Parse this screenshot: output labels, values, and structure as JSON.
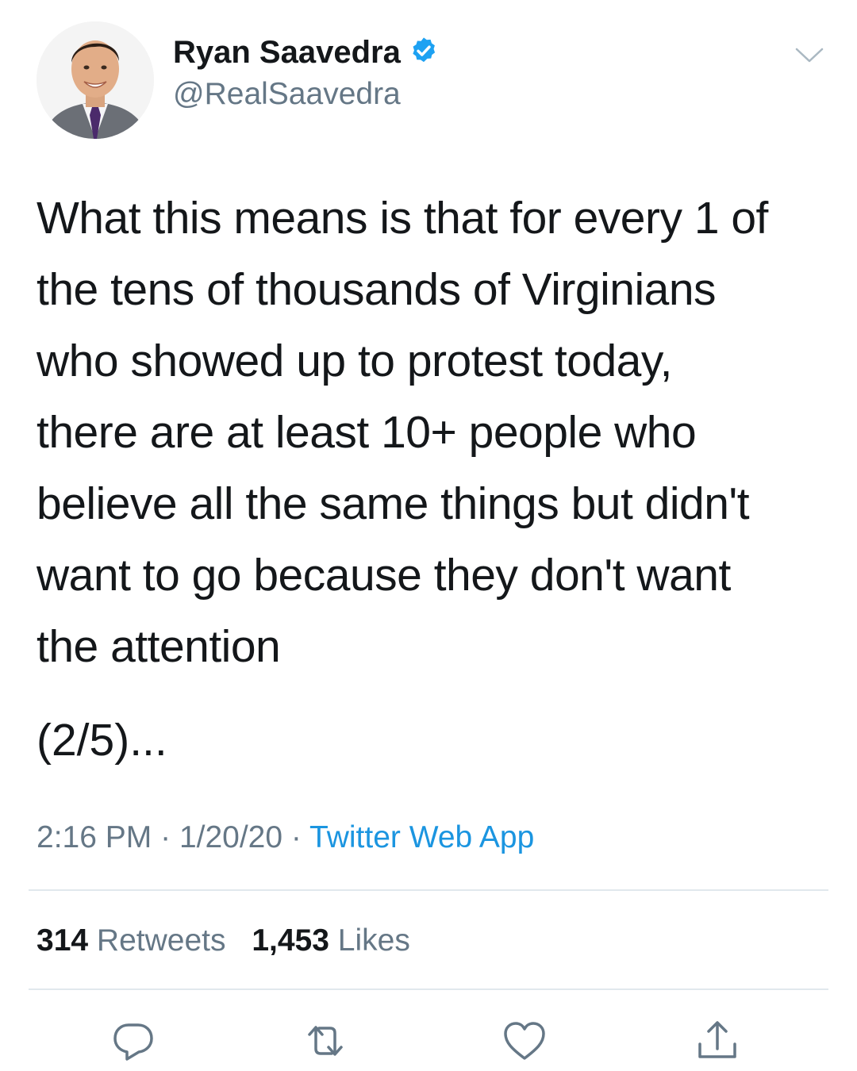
{
  "author": {
    "name": "Ryan Saavedra",
    "handle": "@RealSaavedra",
    "verified": true
  },
  "tweet": {
    "lines": [
      "What this means is that for every 1 of",
      "the tens of thousands of Virginians",
      "who showed up to protest today,",
      "there are at least 10+ people who",
      "believe all the same things but didn't",
      "want to go because they don't want",
      "the attention"
    ],
    "thread_marker": "(2/5)..."
  },
  "meta": {
    "time": "2:16 PM",
    "date": "1/20/20",
    "separator": "·",
    "source": "Twitter Web App"
  },
  "stats": {
    "retweets_count": "314",
    "retweets_label": "Retweets",
    "likes_count": "1,453",
    "likes_label": "Likes"
  },
  "colors": {
    "text": "#14171a",
    "secondary": "#657786",
    "link": "#1b95e0",
    "divider": "#e1e8ed",
    "verified": "#1da1f2"
  },
  "icons": [
    "verified-badge-icon",
    "chevron-down-icon",
    "reply-icon",
    "retweet-icon",
    "like-icon",
    "share-icon"
  ]
}
